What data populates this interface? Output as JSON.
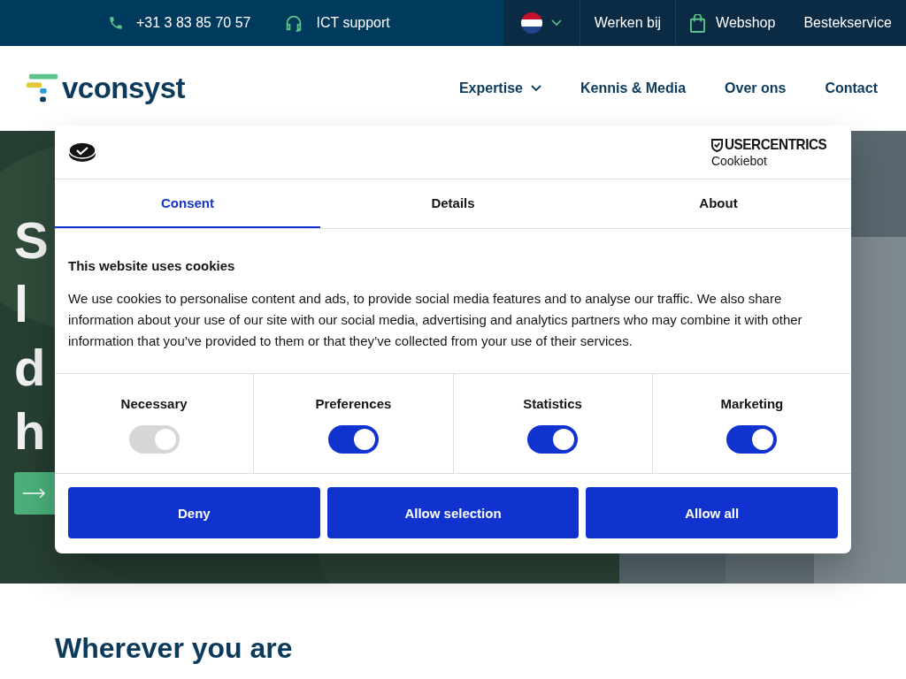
{
  "top_bar": {
    "phone": "+31 3 83 85 70 57",
    "support": "ICT support",
    "links": [
      {
        "label": "Werken bij",
        "kind": "plain"
      },
      {
        "label": "Webshop",
        "kind": "shop"
      },
      {
        "label": "Bestekservice",
        "kind": "plain"
      }
    ]
  },
  "header": {
    "logo": "vconsyst",
    "nav": [
      {
        "label": "Expertise",
        "dropdown": true
      },
      {
        "label": "Kennis & Media",
        "dropdown": false
      },
      {
        "label": "Over ons",
        "dropdown": false
      },
      {
        "label": "Contact",
        "dropdown": false
      }
    ]
  },
  "hero": {
    "heading_lines": [
      "S",
      "l",
      "d",
      "h"
    ]
  },
  "section": {
    "title": "Wherever you are"
  },
  "cookie_dialog": {
    "brand": "USERCENTRICS",
    "brand_sub": "Cookiebot",
    "tabs": [
      {
        "label": "Consent",
        "selected": true
      },
      {
        "label": "Details",
        "selected": false
      },
      {
        "label": "About",
        "selected": false
      }
    ],
    "title": "This website uses cookies",
    "text": "We use cookies to personalise content and ads, to provide social media features and to analyse our traffic. We also share information about your use of our site with our social media, advertising and analytics partners who may combine it with other information that you’ve provided to them or that they’ve collected from your use of their services.",
    "categories": [
      {
        "label": "Necessary",
        "checked": true,
        "disabled": true
      },
      {
        "label": "Preferences",
        "checked": true,
        "disabled": false
      },
      {
        "label": "Statistics",
        "checked": true,
        "disabled": false
      },
      {
        "label": "Marketing",
        "checked": true,
        "disabled": false
      }
    ],
    "buttons": [
      "Deny",
      "Allow selection",
      "Allow all"
    ]
  }
}
